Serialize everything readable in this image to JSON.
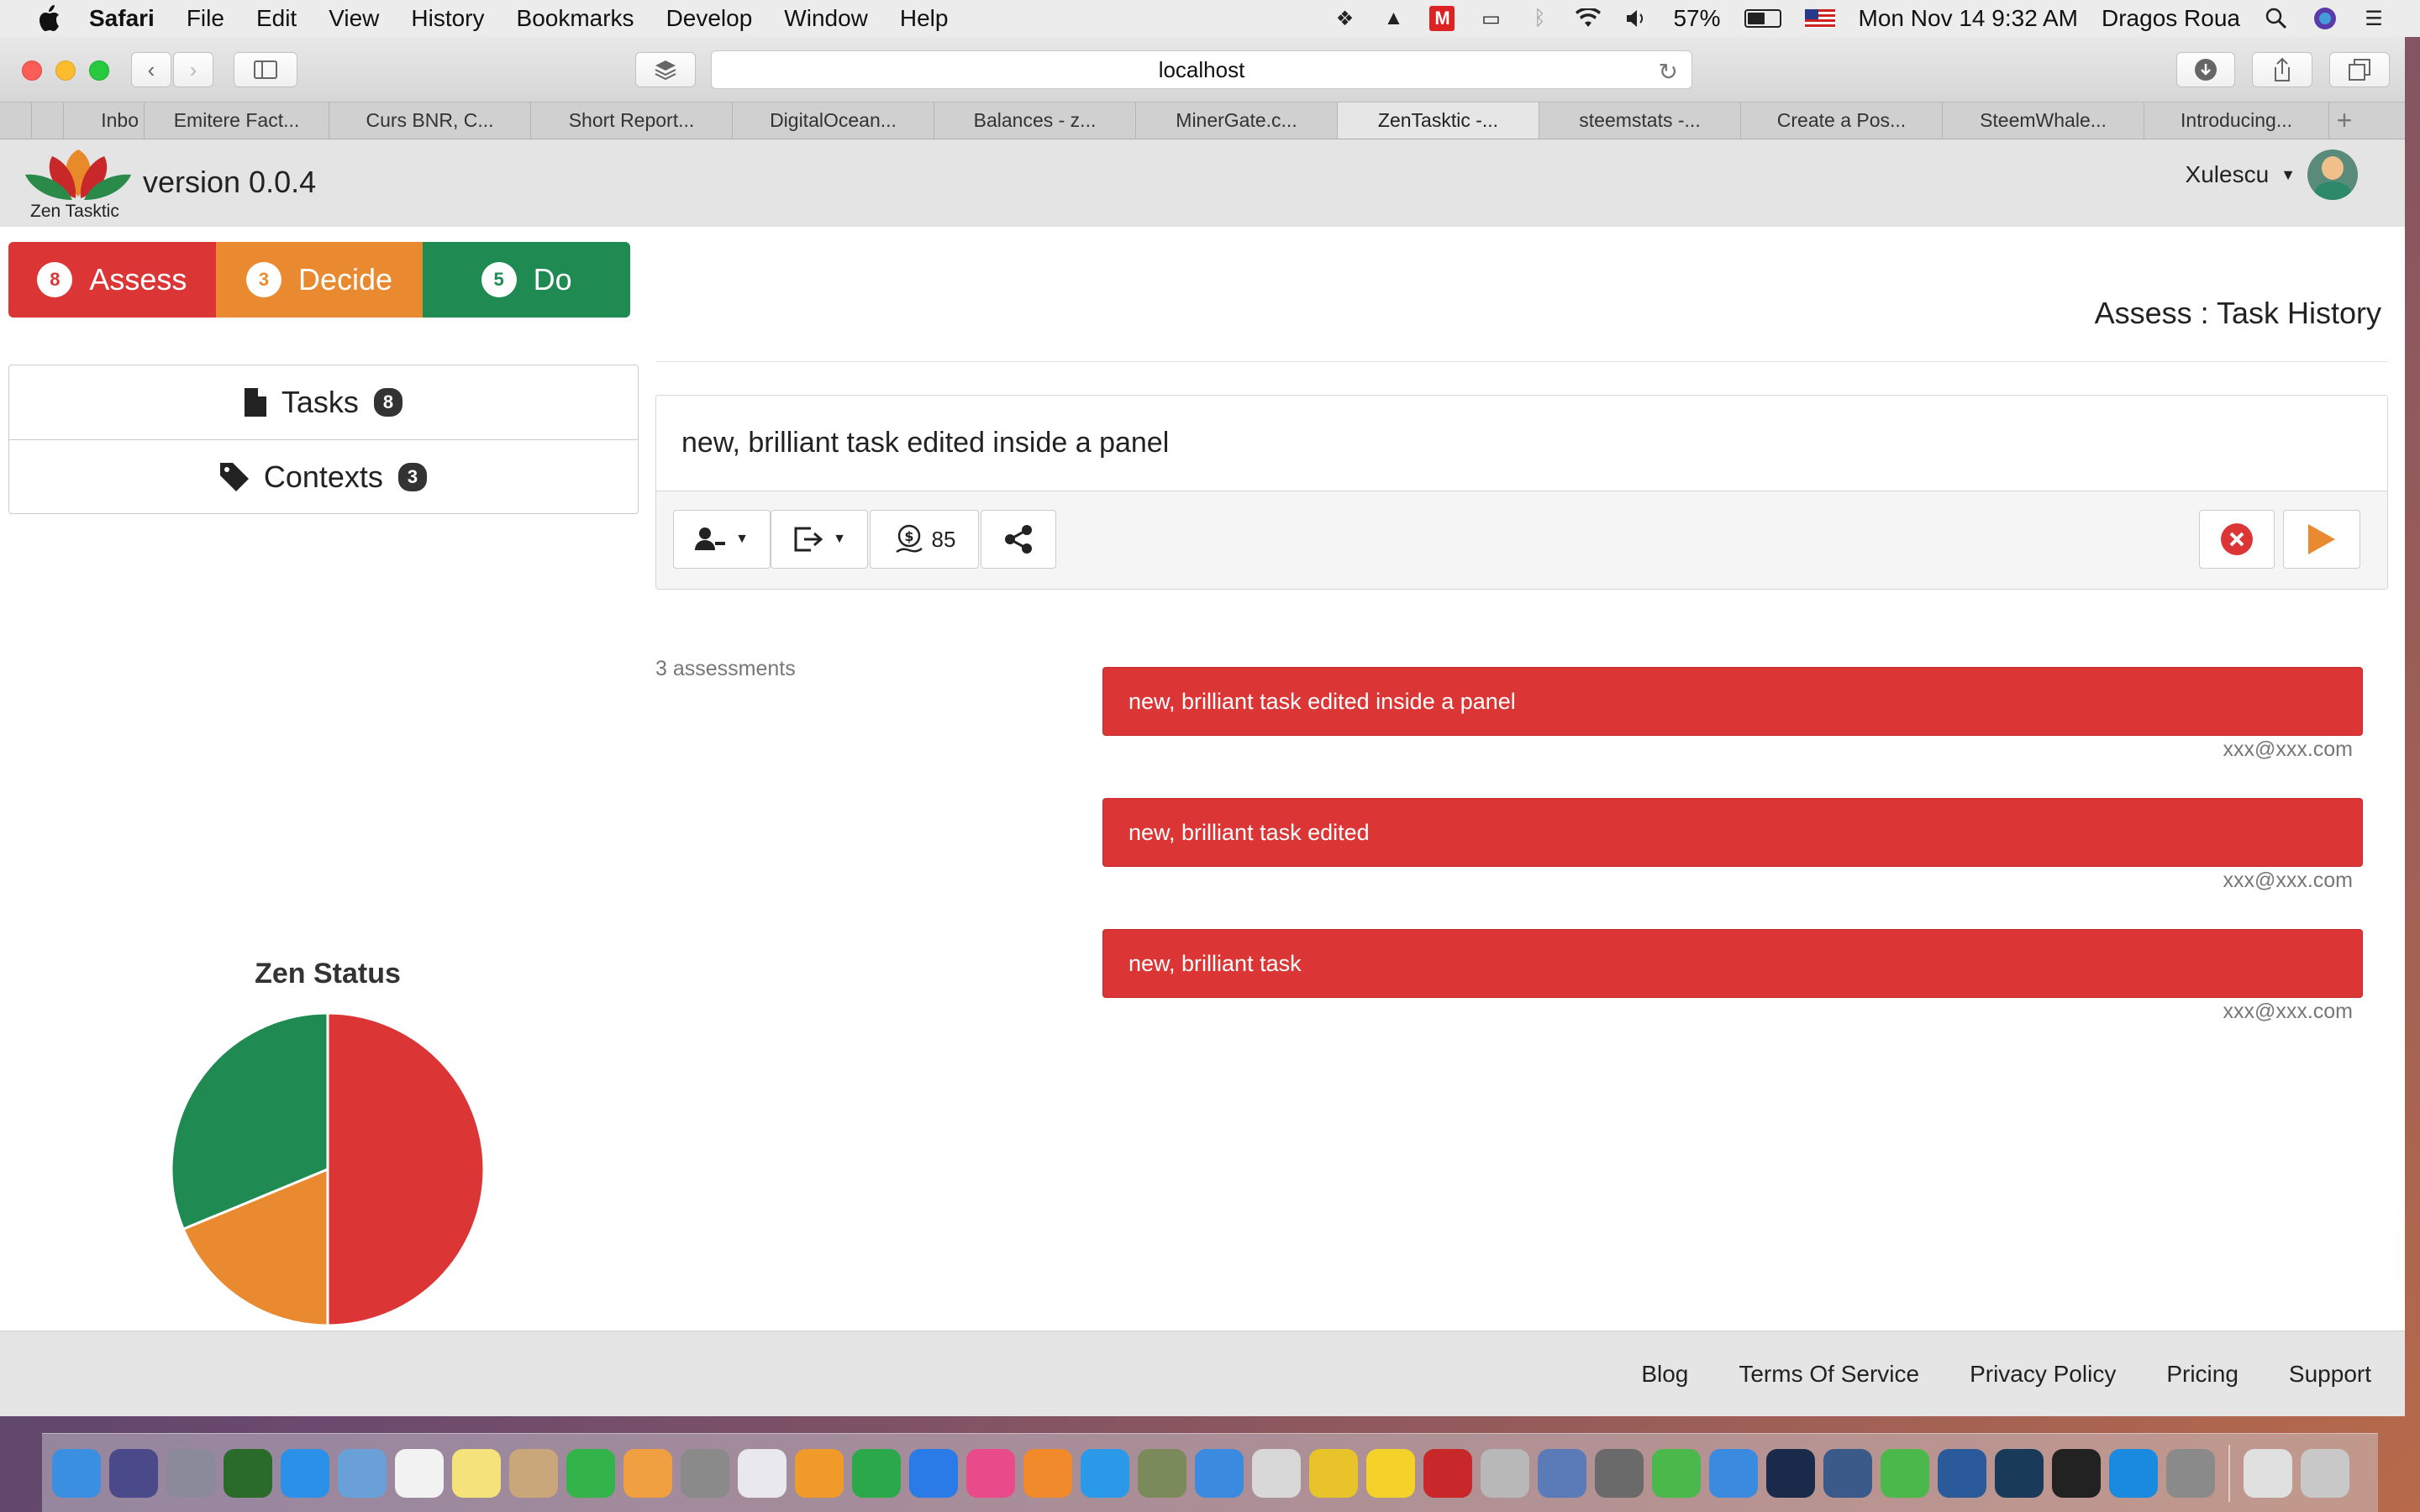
{
  "menubar": {
    "apple_icon": "apple-logo-icon",
    "items": [
      "Safari",
      "File",
      "Edit",
      "View",
      "History",
      "Bookmarks",
      "Develop",
      "Window",
      "Help"
    ],
    "battery_percent": "57%",
    "battery_level": 0.57,
    "clock": "Mon Nov 14  9:32 AM",
    "user_name": "Dragos Roua",
    "status_icons": [
      "dropbox-icon",
      "google-drive-icon",
      "gmail-icon",
      "airplay-icon",
      "bluetooth-icon",
      "wifi-icon",
      "volume-icon"
    ]
  },
  "browser": {
    "url": "localhost",
    "tabs": [
      "Inbo",
      "Emitere Fact...",
      "Curs BNR, C...",
      "Short Report...",
      "DigitalOcean...",
      "Balances - z...",
      "MinerGate.c...",
      "ZenTasktic -...",
      "steemstats -...",
      "Create a Pos...",
      "SteemWhale...",
      "Introducing..."
    ],
    "active_tab_index": 7
  },
  "app": {
    "logo_text": "Zen Tasktic",
    "version": "version 0.0.4",
    "user": "Xulescu",
    "colors": {
      "assess": "#dc3535",
      "decide": "#ea8a30",
      "do": "#1f8a52"
    }
  },
  "phases": [
    {
      "label": "Assess",
      "count": "8"
    },
    {
      "label": "Decide",
      "count": "3"
    },
    {
      "label": "Do",
      "count": "5"
    }
  ],
  "nav": [
    {
      "label": "Tasks",
      "count": "8",
      "icon": "file-icon"
    },
    {
      "label": "Contexts",
      "count": "3",
      "icon": "tag-icon"
    }
  ],
  "page": {
    "heading": "Assess : Task History",
    "task_title": "new, brilliant task edited inside a panel",
    "coin_value": "85",
    "assessments_count": "3 assessments",
    "assessments": [
      {
        "text": "new, brilliant task edited inside a panel",
        "author": "xxx@xxx.com"
      },
      {
        "text": "new, brilliant task edited",
        "author": "xxx@xxx.com"
      },
      {
        "text": "new, brilliant task",
        "author": "xxx@xxx.com"
      }
    ]
  },
  "chart_data": {
    "type": "pie",
    "title": "Zen Status",
    "slices": [
      {
        "label": "Assess",
        "value": 8,
        "color": "#dc3535"
      },
      {
        "label": "Decide",
        "value": 3,
        "color": "#ea8a30"
      },
      {
        "label": "Do",
        "value": 5,
        "color": "#1f8a52"
      }
    ]
  },
  "footer": {
    "links": [
      "Blog",
      "Terms Of Service",
      "Privacy Policy",
      "Pricing",
      "Support"
    ]
  },
  "dock": {
    "apps": [
      {
        "name": "finder",
        "color": "#3b8fe0"
      },
      {
        "name": "siri",
        "color": "#4a4a8a"
      },
      {
        "name": "launchpad",
        "color": "#8a8a9a"
      },
      {
        "name": "mission-control",
        "color": "#2a6a2a"
      },
      {
        "name": "safari",
        "color": "#2a90e8"
      },
      {
        "name": "preview",
        "color": "#6aa0d8"
      },
      {
        "name": "calendar",
        "color": "#f2f2f2"
      },
      {
        "name": "notes",
        "color": "#f5e27a"
      },
      {
        "name": "contacts",
        "color": "#c9a77a"
      },
      {
        "name": "facetime",
        "color": "#33b44a"
      },
      {
        "name": "photos",
        "color": "#f0a040"
      },
      {
        "name": "system-preferences",
        "color": "#8a8a8a"
      },
      {
        "name": "textedit",
        "color": "#e8e8ee"
      },
      {
        "name": "pages",
        "color": "#f09a2a"
      },
      {
        "name": "numbers",
        "color": "#2aa84a"
      },
      {
        "name": "keynote",
        "color": "#2a7ae8"
      },
      {
        "name": "itunes",
        "color": "#e84a8a"
      },
      {
        "name": "ibooks",
        "color": "#f08a2a"
      },
      {
        "name": "app-store",
        "color": "#2a9ae8"
      },
      {
        "name": "script-editor",
        "color": "#7a8a5a"
      },
      {
        "name": "xcode",
        "color": "#3a8ae0"
      },
      {
        "name": "scrivener",
        "color": "#d8d8d8"
      },
      {
        "name": "chrome",
        "color": "#e8c32a"
      },
      {
        "name": "cyberduck",
        "color": "#f5d22a"
      },
      {
        "name": "filezilla",
        "color": "#c8282a"
      },
      {
        "name": "disk-utility",
        "color": "#b8b8b8"
      },
      {
        "name": "image-capture",
        "color": "#5a7ab8"
      },
      {
        "name": "automator",
        "color": "#6a6a6a"
      },
      {
        "name": "evernote",
        "color": "#4ab84a"
      },
      {
        "name": "simplenote",
        "color": "#3a8ae0"
      },
      {
        "name": "kindle",
        "color": "#1a2a4a"
      },
      {
        "name": "ethereum-wallet",
        "color": "#3a5a8a"
      },
      {
        "name": "mist",
        "color": "#4ab84a"
      },
      {
        "name": "mountain-app",
        "color": "#2a5a9a"
      },
      {
        "name": "jaxx",
        "color": "#1a3a5a"
      },
      {
        "name": "terminal",
        "color": "#222222"
      },
      {
        "name": "vscode",
        "color": "#1a8ae0"
      },
      {
        "name": "calculator",
        "color": "#8a8a8a"
      },
      {
        "name": "documents",
        "color": "#e0e0e0"
      },
      {
        "name": "trash",
        "color": "#c8c8c8"
      }
    ]
  }
}
